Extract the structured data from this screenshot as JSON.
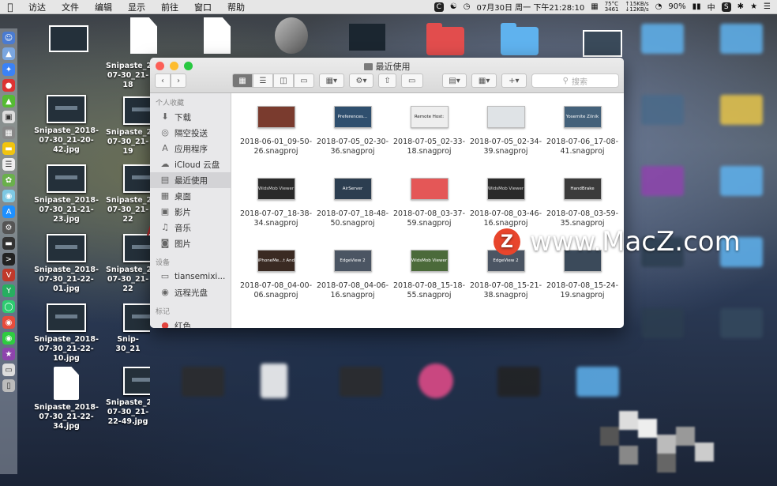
{
  "menubar": {
    "items": [
      "访达",
      "文件",
      "编辑",
      "显示",
      "前往",
      "窗口",
      "帮助"
    ],
    "net_cpu": "75°C",
    "net_freq": "3461",
    "net_up": "↑15KB/s",
    "net_down": "↓12KB/s",
    "datetime": "07月30日 周一 下午21:28:10",
    "battery": "90%",
    "input": "中",
    "c_icon": "C",
    "s_icon": "S"
  },
  "desktop": {
    "icons": [
      {
        "label": "Snipaste_2018-07-30_21-20-42.jpg"
      },
      {
        "label": "Snipaste_2018-07-30_21-18"
      },
      {
        "label": "Snipaste_2018-07-30_21-21-23.jpg"
      },
      {
        "label": "Snipaste_2018-07-30_21-19"
      },
      {
        "label": "Snipaste_2018-07-30_21-22-01.jpg"
      },
      {
        "label": "Snipaste_2018-07-30_21-22"
      },
      {
        "label": "Snipaste_2018-07-30_21-22-10.jpg"
      },
      {
        "label": "Snipaste_2018-07-30_21-22"
      },
      {
        "label": "Snipaste_2018-07-30_21-22-34.jpg"
      },
      {
        "label": "Snip-30_21"
      },
      {
        "label": "Snipaste_2018-07-30_21-22-49.jpg"
      },
      {
        "label": "Snip-30"
      }
    ]
  },
  "finder": {
    "title": "最近使用",
    "search_placeholder": "搜索",
    "sidebar": {
      "favorites_header": "个人收藏",
      "favorites": [
        {
          "label": "下载",
          "icon": "download-icon",
          "glyph": "⬇"
        },
        {
          "label": "隔空投送",
          "icon": "airdrop-icon",
          "glyph": "◎"
        },
        {
          "label": "应用程序",
          "icon": "applications-icon",
          "glyph": "A"
        },
        {
          "label": "iCloud 云盘",
          "icon": "icloud-icon",
          "glyph": "☁"
        },
        {
          "label": "最近使用",
          "icon": "recents-icon",
          "glyph": "▤"
        },
        {
          "label": "桌面",
          "icon": "desktop-icon",
          "glyph": "▦"
        },
        {
          "label": "影片",
          "icon": "movies-icon",
          "glyph": "▣"
        },
        {
          "label": "音乐",
          "icon": "music-icon",
          "glyph": "♫"
        },
        {
          "label": "图片",
          "icon": "pictures-icon",
          "glyph": "◙"
        }
      ],
      "devices_header": "设备",
      "devices": [
        {
          "label": "tiansemixi...",
          "icon": "disk-icon",
          "glyph": "▭"
        },
        {
          "label": "远程光盘",
          "icon": "remote-disc-icon",
          "glyph": "◉"
        }
      ],
      "tags_header": "标记",
      "tags": [
        {
          "label": "红色",
          "icon": "red-tag-icon",
          "glyph": "●"
        }
      ]
    },
    "files": [
      {
        "name": "2018-06-01_09-50-26.snagproj",
        "thumb": "",
        "bg": "#7a3b2e",
        "fg": "#fff"
      },
      {
        "name": "2018-07-05_02-30-36.snagproj",
        "thumb": "Preferences...",
        "bg": "#2f4f6e",
        "fg": "#fff"
      },
      {
        "name": "2018-07-05_02-33-18.snagproj",
        "thumb": "Remote Host:",
        "bg": "#eeeeee",
        "fg": "#222"
      },
      {
        "name": "2018-07-05_02-34-39.snagproj",
        "thumb": "",
        "bg": "#dfe3e6",
        "fg": "#222"
      },
      {
        "name": "2018-07-06_17-08-41.snagproj",
        "thumb": "Yosemite Zilnik",
        "bg": "#44617a",
        "fg": "#fff"
      },
      {
        "name": "2018-07-07_18-38-34.snagproj",
        "thumb": "WidsMob Viewer",
        "bg": "#2a2a2a",
        "fg": "#ddd"
      },
      {
        "name": "2018-07-07_18-48-50.snagproj",
        "thumb": "AirServer",
        "bg": "#2c3e50",
        "fg": "#fff"
      },
      {
        "name": "2018-07-08_03-37-59.snagproj",
        "thumb": "",
        "bg": "#e45757",
        "fg": "#fff"
      },
      {
        "name": "2018-07-08_03-46-16.snagproj",
        "thumb": "WidsMob Viewer",
        "bg": "#2a2a2a",
        "fg": "#ddd"
      },
      {
        "name": "2018-07-08_03-59-35.snagproj",
        "thumb": "HandBrake",
        "bg": "#3b3b3b",
        "fg": "#fff"
      },
      {
        "name": "2018-07-08_04-00-06.snagproj",
        "thumb": "iPhoneMe...t Android",
        "bg": "#3a2a22",
        "fg": "#fff"
      },
      {
        "name": "2018-07-08_04-06-16.snagproj",
        "thumb": "EdgeView 2",
        "bg": "#4b5563",
        "fg": "#fff"
      },
      {
        "name": "2018-07-08_15-18-55.snagproj",
        "thumb": "WidsMob Viewer",
        "bg": "#4b6a3a",
        "fg": "#fff"
      },
      {
        "name": "2018-07-08_15-21-38.snagproj",
        "thumb": "EdgeView 2",
        "bg": "#4b5563",
        "fg": "#fff"
      },
      {
        "name": "2018-07-08_15-24-19.snagproj",
        "thumb": "",
        "bg": "#3b4a5a",
        "fg": "#fff"
      }
    ]
  },
  "watermark": {
    "logo": "Z",
    "text": "www.MacZ.com"
  },
  "colors": {
    "close": "#fc5f57",
    "minimize": "#fdbc2e",
    "zoom": "#28c840",
    "arrow": "#c0282b"
  }
}
